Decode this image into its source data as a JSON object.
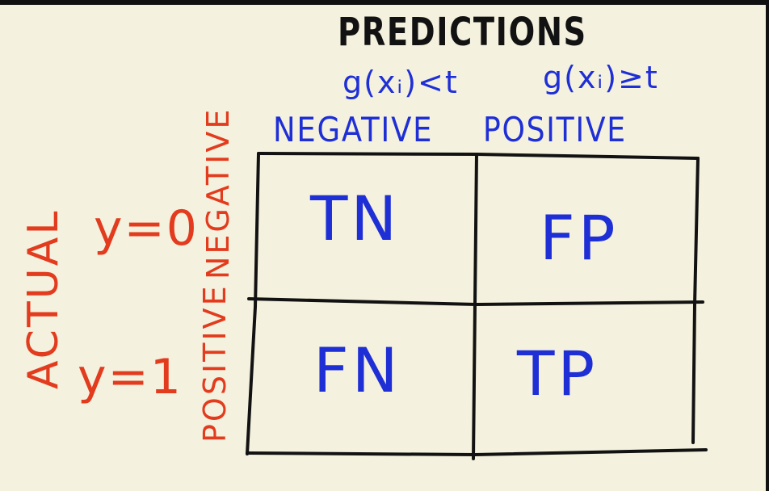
{
  "diagram": {
    "title": "PREDICTIONS",
    "conditions": {
      "negative": "g(xᵢ)<t",
      "positive": "g(xᵢ)≥t"
    },
    "columns": {
      "negative": "NEGATIVE",
      "positive": "POSITIVE"
    },
    "actual_label": "ACTUAL",
    "rows": {
      "y0": "y=0",
      "y1": "y=1",
      "negative": "NEGATIVE",
      "positive": "POSITIVE"
    },
    "cells": {
      "tn": "TN",
      "fp": "FP",
      "fn": "FN",
      "tp": "TP"
    }
  },
  "colors": {
    "background": "#f4f1de",
    "ink_black": "#121212",
    "ink_blue": "#1f2fd6",
    "ink_red": "#e23b1e"
  }
}
